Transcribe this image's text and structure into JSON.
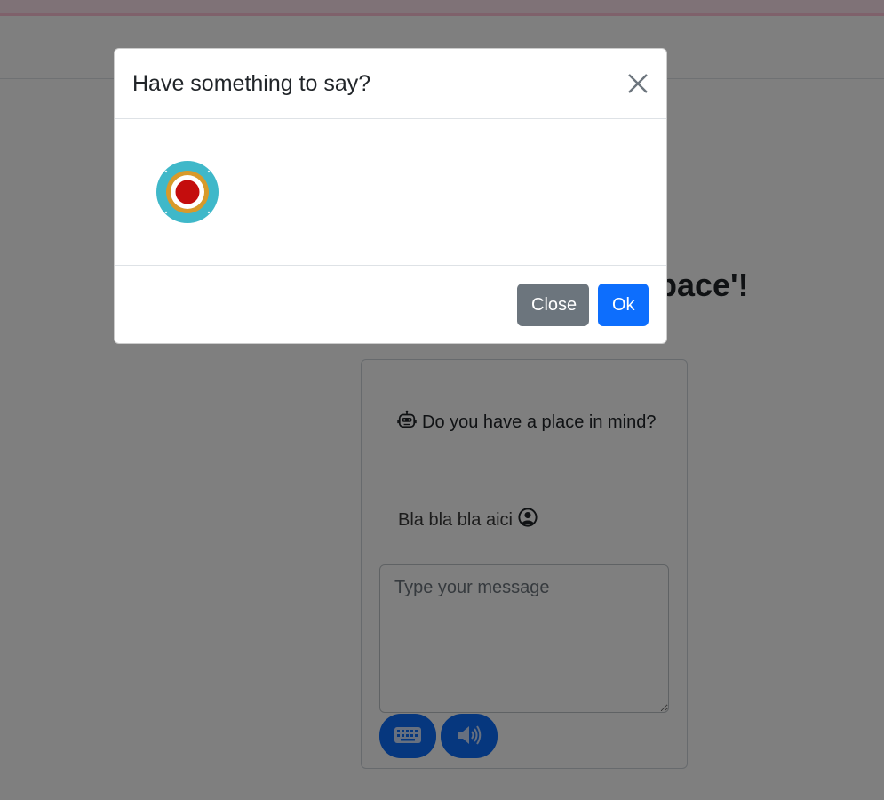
{
  "page": {
    "heading": "pace'!"
  },
  "chat": {
    "bot_message": "Do you have a place in mind?",
    "user_message": "Bla bla bla aici",
    "input_placeholder": "Type your message",
    "input_value": "",
    "bot_icon": "robot-icon",
    "user_icon": "user-circle-icon",
    "keyboard_icon": "keyboard-icon",
    "speaker_icon": "speaker-icon"
  },
  "modal": {
    "title": "Have something to say?",
    "close_icon": "close-icon",
    "record_icon": "record-icon",
    "close_label": "Close",
    "ok_label": "Ok"
  },
  "colors": {
    "primary": "#0d6efd",
    "secondary": "#6c757d",
    "record_ring": "#3fb8c9",
    "record_gold": "#d89a2a",
    "record_red": "#c40d0d"
  }
}
